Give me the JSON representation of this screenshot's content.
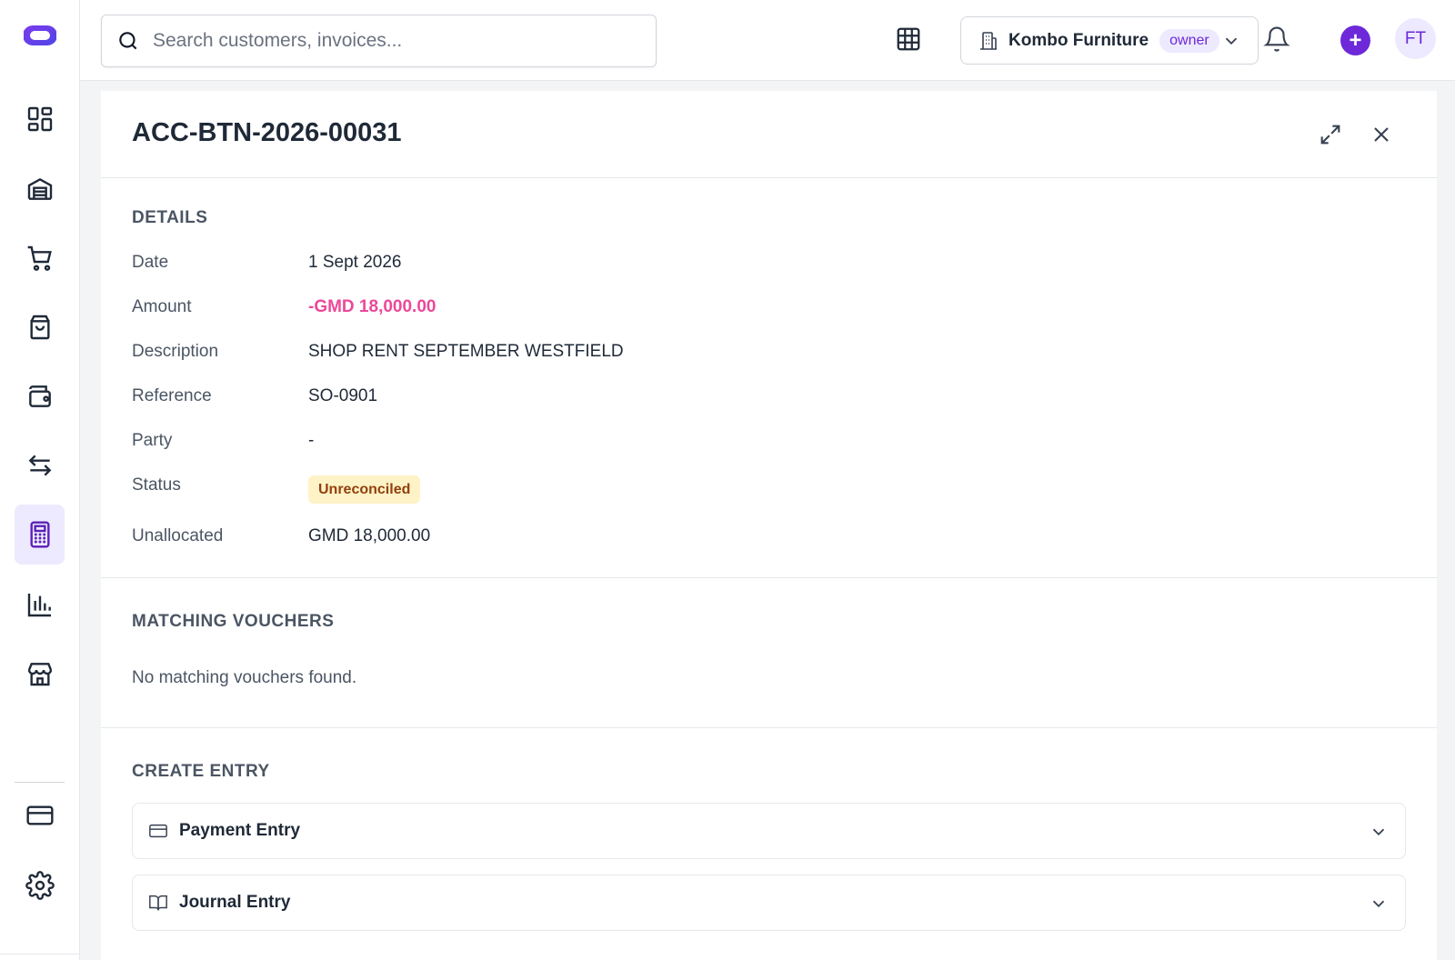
{
  "search": {
    "placeholder": "Search customers, invoices..."
  },
  "company": {
    "name": "Kombo Furniture",
    "role": "owner"
  },
  "user": {
    "initials": "FT"
  },
  "add_label": "+",
  "sidebar": {
    "items": [
      {
        "name": "dashboard",
        "icon": "dashboard-icon",
        "active": false
      },
      {
        "name": "inventory",
        "icon": "warehouse-icon",
        "active": false
      },
      {
        "name": "sales",
        "icon": "cart-icon",
        "active": false
      },
      {
        "name": "purchases",
        "icon": "bag-icon",
        "active": false
      },
      {
        "name": "wallet",
        "icon": "wallet-icon",
        "active": false
      },
      {
        "name": "transfers",
        "icon": "transfer-icon",
        "active": false
      },
      {
        "name": "accounting",
        "icon": "calculator-icon",
        "active": true
      },
      {
        "name": "reports",
        "icon": "chart-icon",
        "active": false
      },
      {
        "name": "store",
        "icon": "store-icon",
        "active": false
      },
      {
        "name": "billing",
        "icon": "card-icon",
        "active": false
      },
      {
        "name": "settings",
        "icon": "gear-icon",
        "active": false
      }
    ]
  },
  "panel": {
    "title": "ACC-BTN-2026-00031",
    "details": {
      "section_title": "DETAILS",
      "date_label": "Date",
      "date_value": "1 Sept 2026",
      "amount_label": "Amount",
      "amount_value": "-GMD 18,000.00",
      "description_label": "Description",
      "description_value": "SHOP RENT SEPTEMBER WESTFIELD",
      "reference_label": "Reference",
      "reference_value": "SO-0901",
      "party_label": "Party",
      "party_value": "-",
      "status_label": "Status",
      "status_value": "Unreconciled",
      "unallocated_label": "Unallocated",
      "unallocated_value": "GMD 18,000.00"
    },
    "matching": {
      "section_title": "MATCHING VOUCHERS",
      "empty_message": "No matching vouchers found."
    },
    "create": {
      "section_title": "CREATE ENTRY",
      "payment_label": "Payment Entry",
      "journal_label": "Journal Entry"
    }
  },
  "colors": {
    "accent": "#6d28d9",
    "negative_amount": "#ec4899",
    "status_bg": "#fef3c7",
    "status_text": "#92400e"
  }
}
